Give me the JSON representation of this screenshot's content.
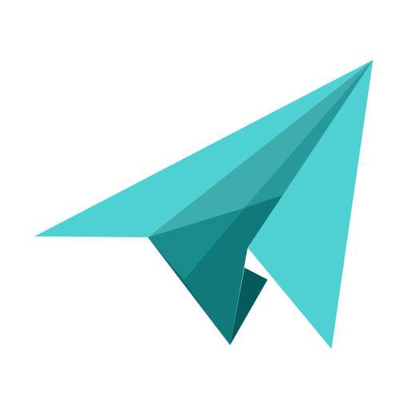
{
  "icon": {
    "name": "paper-plane-icon",
    "colors": {
      "light": "#4FD1D3",
      "mid": "#3EADAD",
      "mid_dark": "#26999A",
      "dark": "#178C8B",
      "darker": "#10797A",
      "darkest": "#0A6A6B",
      "shadow": "#055B5C",
      "background": "#FFFFFF"
    }
  }
}
